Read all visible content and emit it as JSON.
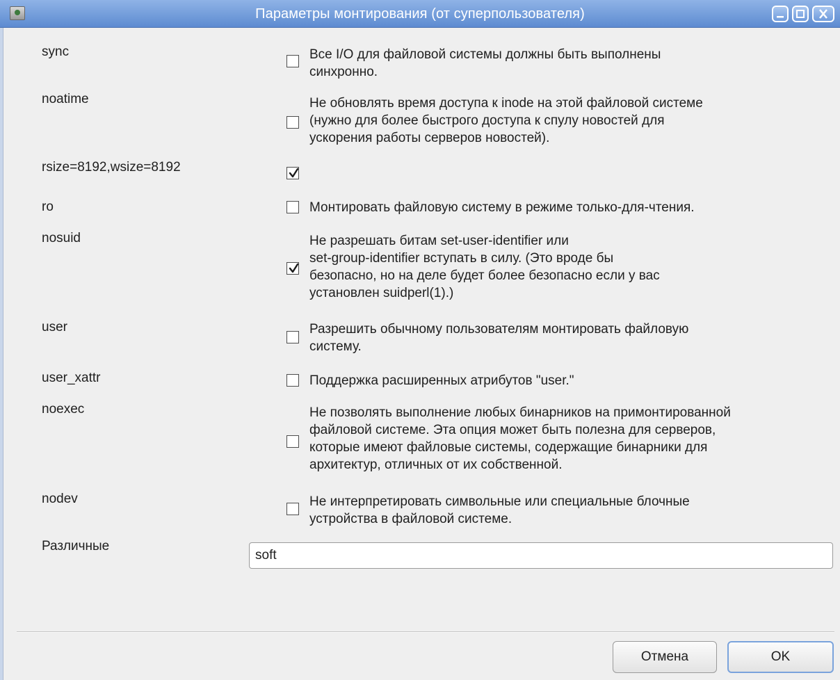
{
  "window": {
    "title": "Параметры монтирования (от суперпользователя)",
    "controls": {
      "minimize": "minimize",
      "maximize": "maximize",
      "close": "close"
    }
  },
  "options": [
    {
      "name": "sync",
      "checked": false,
      "desc": [
        "Все I/O для файловой системы должны быть выполнены",
        "синхронно."
      ]
    },
    {
      "name": "noatime",
      "checked": false,
      "desc": [
        "Не обновлять время доступа к inode на этой файловой системе",
        "(нужно для более быстрого доступа к спулу новостей для",
        "ускорения работы серверов новостей)."
      ]
    },
    {
      "name": "rsize=8192,wsize=8192",
      "checked": true,
      "desc": []
    },
    {
      "name": "ro",
      "checked": false,
      "desc": [
        "Монтировать файловую систему в режиме только-для-чтения."
      ]
    },
    {
      "name": "nosuid",
      "checked": true,
      "desc": [
        "Не разрешать битам set-user-identifier или",
        "set-group-identifier вступать в силу. (Это вроде бы",
        "безопасно, но на деле будет более безопасно если у вас",
        "установлен suidperl(1).)"
      ]
    },
    {
      "name": "user",
      "checked": false,
      "desc": [
        "Разрешить обычному пользователям монтировать файловую",
        "систему."
      ]
    },
    {
      "name": "user_xattr",
      "checked": false,
      "desc": [
        "Поддержка расширенных атрибутов \"user.\""
      ]
    },
    {
      "name": "noexec",
      "checked": false,
      "desc": [
        "Не позволять выполнение любых бинарников на примонтированной",
        "файловой системе. Эта опция может быть полезна для серверов,",
        "которые имеют файловые системы, содержащие бинарники для",
        "архитектур, отличных от их собственной."
      ]
    },
    {
      "name": "nodev",
      "checked": false,
      "desc": [
        "Не интерпретировать символьные или специальные блочные",
        "устройства в файловой системе."
      ]
    }
  ],
  "misc": {
    "label": "Различные",
    "value": "soft"
  },
  "buttons": {
    "cancel": "Отмена",
    "ok": "OK"
  },
  "colors": {
    "titlebar": "#6f9bdc",
    "focus_border": "#7aa3dc",
    "background": "#efefef"
  }
}
